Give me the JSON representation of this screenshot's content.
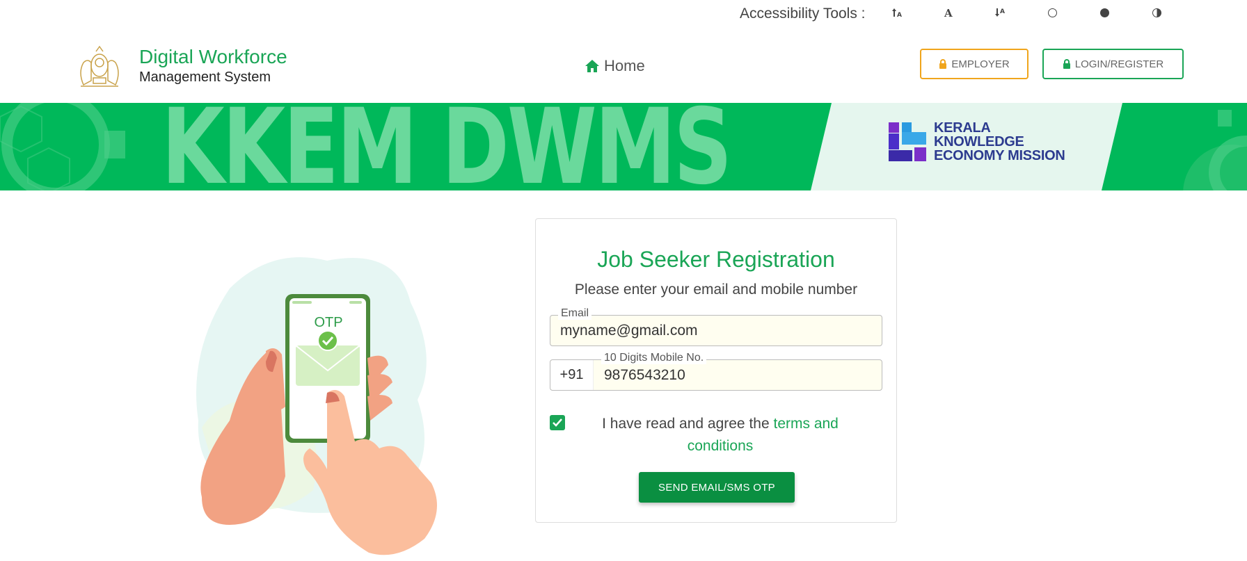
{
  "accessibility": {
    "label": "Accessibility Tools :",
    "tools": [
      "text-increase-icon",
      "text-normal-icon",
      "text-decrease-icon",
      "light-mode-icon",
      "dark-mode-icon",
      "contrast-icon"
    ]
  },
  "header": {
    "brand_title": "Digital Workforce",
    "brand_subtitle": "Management System",
    "nav_home": "Home",
    "employer_button": "EMPLOYER",
    "login_button": "LOGIN/REGISTER"
  },
  "banner": {
    "text": "KKEM DWMS",
    "partner_line1": "KERALA",
    "partner_line2": "KNOWLEDGE",
    "partner_line3": "ECONOMY MISSION"
  },
  "illustration": {
    "otp_text": "OTP"
  },
  "form": {
    "title": "Job Seeker Registration",
    "subtitle": "Please enter your email and mobile number",
    "email_label": "Email",
    "email_value": "myname@gmail.com",
    "mobile_label": "10 Digits Mobile No.",
    "mobile_prefix": "+91",
    "mobile_value": "9876543210",
    "agree_text": "I have read and agree the ",
    "terms_link": "terms and conditions",
    "checkbox_checked": true,
    "submit_button": "SEND EMAIL/SMS OTP"
  },
  "colors": {
    "brand_green": "#1aa556",
    "banner_green": "#00b85a",
    "employer_orange": "#f0a51c",
    "kkem_navy": "#2c3b8f"
  }
}
